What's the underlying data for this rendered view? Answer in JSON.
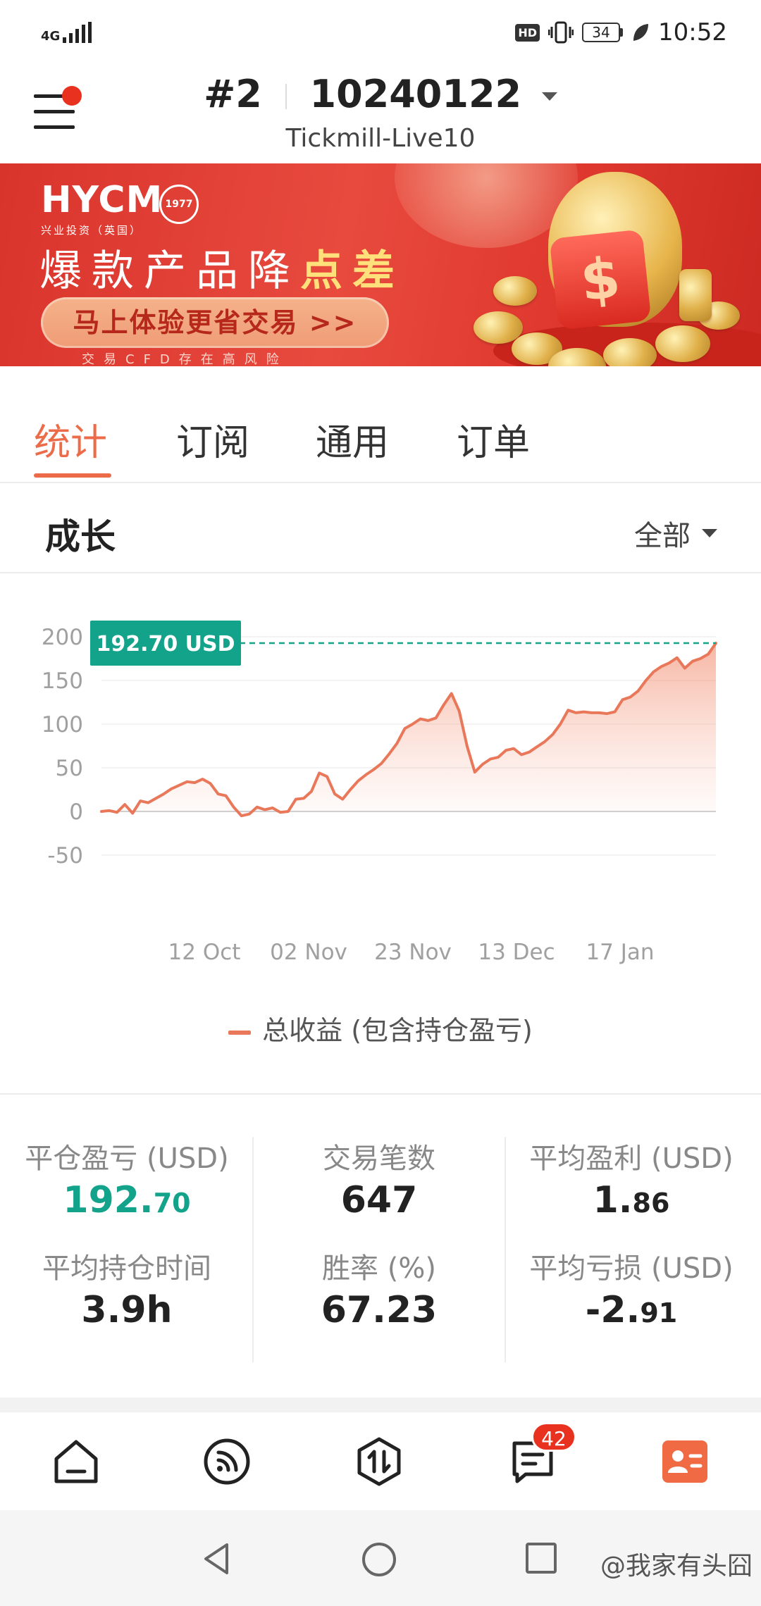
{
  "status_bar": {
    "network": "4G",
    "battery_level": "34",
    "time": "10:52",
    "hd_label": "HD"
  },
  "header": {
    "account_prefix": "#2",
    "account_number": "10240122",
    "server": "Tickmill-Live10",
    "menu_notification": true
  },
  "banner": {
    "brand": "HYCM",
    "brand_seal": "1977",
    "brand_subtitle": "兴业投资（英国）",
    "headline_main": "爆款产品降",
    "headline_highlight": "点差",
    "cta_label": "马上体验更省交易 >>",
    "risk_notice": "交易CFD存在高风险"
  },
  "tabs": [
    {
      "label": "统计",
      "active": true
    },
    {
      "label": "订阅",
      "active": false
    },
    {
      "label": "通用",
      "active": false
    },
    {
      "label": "订单",
      "active": false
    }
  ],
  "growth": {
    "title": "成长",
    "range_label": "全部"
  },
  "chart_data": {
    "type": "area",
    "y_ticks": [
      "200",
      "150",
      "100",
      "50",
      "0",
      "-50"
    ],
    "ylim": [
      -50,
      200
    ],
    "x_tick_labels": [
      "12 Oct",
      "02 Nov",
      "23 Nov",
      "13 Dec",
      "17 Jan"
    ],
    "latest_value_label": "192.70 USD",
    "legend": "总收益 (包含持仓盈亏)",
    "series": [
      {
        "name": "总收益 (包含持仓盈亏)",
        "color": "#e9785a",
        "values": [
          0,
          1,
          -1,
          8,
          -2,
          12,
          10,
          15,
          20,
          26,
          30,
          34,
          33,
          37,
          32,
          20,
          18,
          5,
          -5,
          -3,
          5,
          2,
          4,
          -1,
          0,
          14,
          15,
          23,
          44,
          40,
          20,
          14,
          25,
          35,
          42,
          48,
          55,
          66,
          78,
          95,
          100,
          106,
          104,
          107,
          122,
          135,
          115,
          75,
          45,
          54,
          60,
          62,
          70,
          72,
          65,
          68,
          74,
          80,
          88,
          100,
          116,
          113,
          114,
          113,
          113,
          112,
          114,
          128,
          131,
          138,
          150,
          160,
          166,
          170,
          176,
          164,
          172,
          175,
          180,
          192.7
        ]
      }
    ]
  },
  "stats": {
    "closed_pnl": {
      "label": "平仓盈亏 (USD)",
      "int": "192.",
      "dec": "70"
    },
    "trade_count": {
      "label": "交易笔数",
      "value": "647"
    },
    "avg_profit": {
      "label": "平均盈利 (USD)",
      "int": "1.",
      "dec": "86"
    },
    "avg_hold_time": {
      "label": "平均持仓时间",
      "value": "3.9h"
    },
    "win_rate": {
      "label": "胜率 (%)",
      "value": "67.23"
    },
    "avg_loss": {
      "label": "平均亏损 (USD)",
      "int": "-2.",
      "dec": "91"
    }
  },
  "bottom_nav": {
    "items": [
      "home-icon",
      "feed-icon",
      "trade-icon",
      "messages-icon",
      "profile-icon"
    ],
    "messages_badge": "42",
    "active_item": "profile-icon",
    "accent_color": "#f06a43"
  },
  "watermark": "@我家有头囧",
  "colors": {
    "accent": "#ec6b48",
    "positive": "#13a38b",
    "callout_bg": "#13a38b"
  }
}
